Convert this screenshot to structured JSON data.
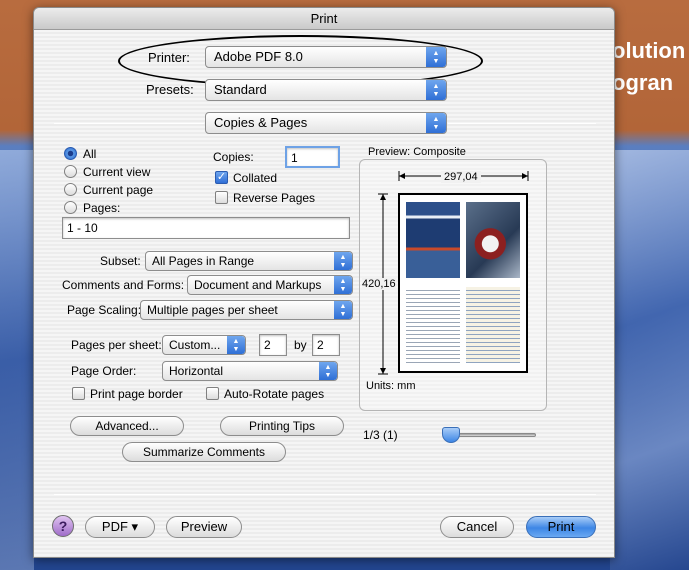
{
  "dialog": {
    "title": "Print"
  },
  "background": {
    "line1": "olution",
    "line2": "ogran"
  },
  "printer": {
    "label": "Printer:",
    "value": "Adobe PDF 8.0"
  },
  "presets": {
    "label": "Presets:",
    "value": "Standard"
  },
  "section": {
    "value": "Copies & Pages"
  },
  "range": {
    "all": "All",
    "current_view": "Current view",
    "current_page": "Current page",
    "pages": "Pages:",
    "pages_value": "1 - 10",
    "selected": "all"
  },
  "copies": {
    "label": "Copies:",
    "value": "1",
    "collated": "Collated",
    "collated_checked": true,
    "reverse": "Reverse Pages",
    "reverse_checked": false
  },
  "subset": {
    "label": "Subset:",
    "value": "All Pages in Range"
  },
  "comments_forms": {
    "label": "Comments and Forms:",
    "value": "Document and Markups"
  },
  "page_scaling": {
    "label": "Page Scaling:",
    "value": "Multiple pages per sheet"
  },
  "pages_per_sheet": {
    "label": "Pages per sheet:",
    "value": "Custom...",
    "cols": "2",
    "by": "by",
    "rows": "2"
  },
  "page_order": {
    "label": "Page Order:",
    "value": "Horizontal"
  },
  "print_border": {
    "label": "Print page border",
    "checked": false
  },
  "auto_rotate": {
    "label": "Auto-Rotate pages",
    "checked": false
  },
  "buttons": {
    "advanced": "Advanced...",
    "printing_tips": "Printing Tips",
    "summarize": "Summarize Comments",
    "help": "?",
    "pdf": "PDF ▾",
    "preview": "Preview",
    "cancel": "Cancel",
    "print": "Print"
  },
  "preview": {
    "title": "Preview: Composite",
    "width": "297,04",
    "height": "420,16",
    "units": "Units: mm",
    "page_indicator": "1/3 (1)",
    "slider_fraction": 0
  },
  "colors": {
    "accent": "#3d86e5",
    "background_top": "#b26538",
    "background_bottom": "#22458f"
  }
}
